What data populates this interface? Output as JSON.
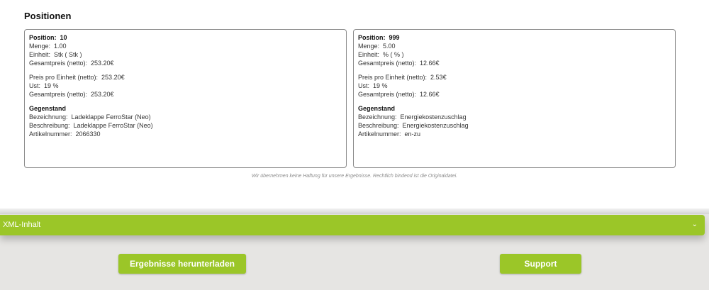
{
  "section_title": "Positionen",
  "positions": [
    {
      "position_label": "Position:",
      "position_value": "10",
      "rows1": [
        {
          "label": "Menge:",
          "value": "1.00"
        },
        {
          "label": "Einheit:",
          "value": "Stk ( Stk )"
        },
        {
          "label": "Gesamtpreis (netto):",
          "value": "253.20€"
        }
      ],
      "rows2": [
        {
          "label": "Preis pro Einheit (netto):",
          "value": "253.20€"
        },
        {
          "label": "Ust:",
          "value": "19 %"
        },
        {
          "label": "Gesamtpreis (netto):",
          "value": "253.20€"
        }
      ],
      "subheading": "Gegenstand",
      "rows3": [
        {
          "label": "Bezeichnung:",
          "value": "Ladeklappe FerroStar (Neo)"
        },
        {
          "label": "Beschreibung:",
          "value": "Ladeklappe FerroStar (Neo)"
        },
        {
          "label": "Artikelnummer:",
          "value": "2066330"
        }
      ]
    },
    {
      "position_label": "Position:",
      "position_value": "999",
      "rows1": [
        {
          "label": "Menge:",
          "value": "5.00"
        },
        {
          "label": "Einheit:",
          "value": "% ( % )"
        },
        {
          "label": "Gesamtpreis (netto):",
          "value": "12.66€"
        }
      ],
      "rows2": [
        {
          "label": "Preis pro Einheit (netto):",
          "value": "2.53€"
        },
        {
          "label": "Ust:",
          "value": "19 %"
        },
        {
          "label": "Gesamtpreis (netto):",
          "value": "12.66€"
        }
      ],
      "subheading": "Gegenstand",
      "rows3": [
        {
          "label": "Bezeichnung:",
          "value": "Energiekostenzuschlag"
        },
        {
          "label": "Beschreibung:",
          "value": "Energiekostenzuschlag"
        },
        {
          "label": "Artikelnummer:",
          "value": "en-zu"
        }
      ]
    }
  ],
  "disclaimer": "Wir übernehmen keine Haftung für unsere Ergebnisse. Rechtlich bindend ist die Originaldatei.",
  "xml_section": {
    "label": "XML-Inhalt",
    "chevron": "⌄",
    "icon": "chevron-down-icon"
  },
  "buttons": {
    "download": "Ergebnisse herunterladen",
    "support": "Support"
  },
  "colors": {
    "accent": "#9bc628",
    "background": "#e6e5e3",
    "panel": "#ffffff"
  }
}
